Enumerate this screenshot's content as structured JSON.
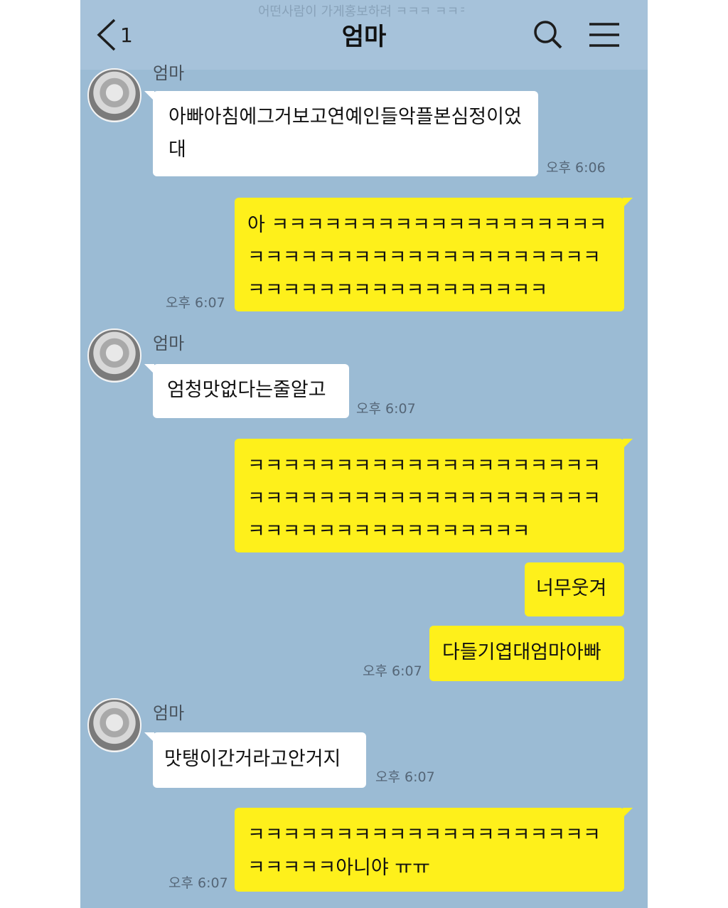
{
  "header": {
    "back_count": "1",
    "title": "엄마",
    "ghost_text": "어떤사람이 가게홍보하려 ㅋㅋㅋ ㅋㅋㅋ"
  },
  "messages": [
    {
      "sender": "엄마",
      "text": "아빠아침에그거보고연예인들악플본심정이었대",
      "time": "오후 6:06"
    },
    {
      "text": "아 ㅋㅋㅋㅋㅋㅋㅋㅋㅋㅋㅋㅋㅋㅋㅋㅋㅋㅋㅋㅋㅋㅋㅋㅋㅋㅋㅋㅋㅋㅋㅋㅋㅋㅋㅋㅋㅋㅋㅋㅋㅋㅋㅋㅋㅋㅋㅋㅋㅋㅋㅋㅋㅋㅋㅋㅋ",
      "time": "오후 6:07"
    },
    {
      "sender": "엄마",
      "text": "엄청맛없다는줄알고",
      "time": "오후 6:07"
    },
    {
      "text": "ㅋㅋㅋㅋㅋㅋㅋㅋㅋㅋㅋㅋㅋㅋㅋㅋㅋㅋㅋㅋㅋㅋㅋㅋㅋㅋㅋㅋㅋㅋㅋㅋㅋㅋㅋㅋㅋㅋㅋㅋㅋㅋㅋㅋㅋㅋㅋㅋㅋㅋㅋㅋㅋㅋㅋㅋ"
    },
    {
      "text": "너무웃겨"
    },
    {
      "text": "다들기엽대엄마아빠",
      "time": "오후 6:07"
    },
    {
      "sender": "엄마",
      "text": "맛탱이간거라고안거지",
      "time": "오후 6:07"
    },
    {
      "text": "ㅋㅋㅋㅋㅋㅋㅋㅋㅋㅋㅋㅋㅋㅋㅋㅋㅋㅋㅋㅋㅋㅋㅋㅋㅋ아니야 ㅠㅠ",
      "time": "오후 6:07"
    }
  ],
  "colors": {
    "background": "#9bbbd4",
    "outgoing_bubble": "#fef01b",
    "incoming_bubble": "#ffffff"
  },
  "icons": [
    "chevron-left-icon",
    "search-icon",
    "menu-icon",
    "avatar"
  ]
}
